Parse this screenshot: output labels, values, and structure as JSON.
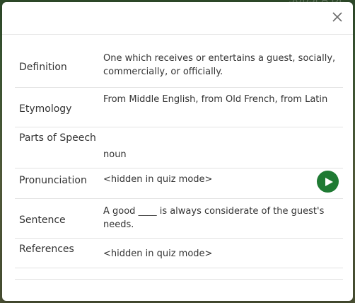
{
  "background": {
    "text": "SUBSEA DE"
  },
  "modal": {
    "rows": [
      {
        "label": "Definition",
        "value": "One which receives or entertains a guest, socially, commercially, or officially."
      },
      {
        "label": "Etymology",
        "value": "From Middle English, from Old French, from Latin"
      },
      {
        "label": "Parts of Speech",
        "value": "noun"
      },
      {
        "label": "Pronunciation",
        "value": "<hidden in quiz mode>"
      },
      {
        "label": "Sentence",
        "value": "A good ____ is always considerate of the guest's needs."
      },
      {
        "label": "References",
        "value": "<hidden in quiz mode>"
      }
    ],
    "icons": {
      "close": "close-icon",
      "play": "play-icon"
    },
    "colors": {
      "play_button": "#1f7a33",
      "divider": "#e3e3e3",
      "text": "#333333"
    }
  }
}
